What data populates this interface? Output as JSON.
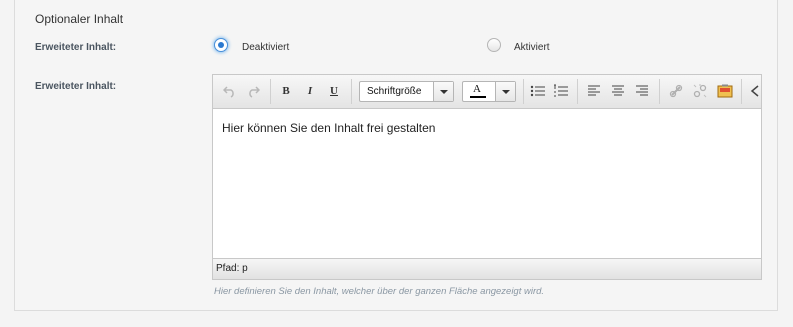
{
  "section": {
    "title": "Optionaler Inhalt"
  },
  "field1": {
    "label": "Erweiteter Inhalt:",
    "options": [
      {
        "label": "Deaktiviert",
        "checked": true
      },
      {
        "label": "Aktiviert",
        "checked": false
      }
    ]
  },
  "field2": {
    "label": "Erweiteter Inhalt:",
    "editor": {
      "toolbar": {
        "undo_icon": "undo-icon",
        "redo_icon": "redo-icon",
        "bold_label": "B",
        "italic_label": "I",
        "underline_label": "U",
        "font_size_label": "Schriftgröße",
        "text_color_label": "A",
        "text_color": "#000000",
        "icons": [
          "bullet-list-icon",
          "numbered-list-icon",
          "align-left-icon",
          "align-center-icon",
          "align-right-icon",
          "link-icon",
          "unlink-icon",
          "image-icon",
          "code-icon"
        ]
      },
      "content": "Hier können Sie den Inhalt frei gestalten",
      "path": "Pfad: p"
    },
    "help": "Hier definieren Sie den Inhalt, welcher über der ganzen Fläche angezeigt wird."
  },
  "colors": {
    "accent": "#2b79d0",
    "label": "#4a5560",
    "help": "#8a97a3"
  }
}
